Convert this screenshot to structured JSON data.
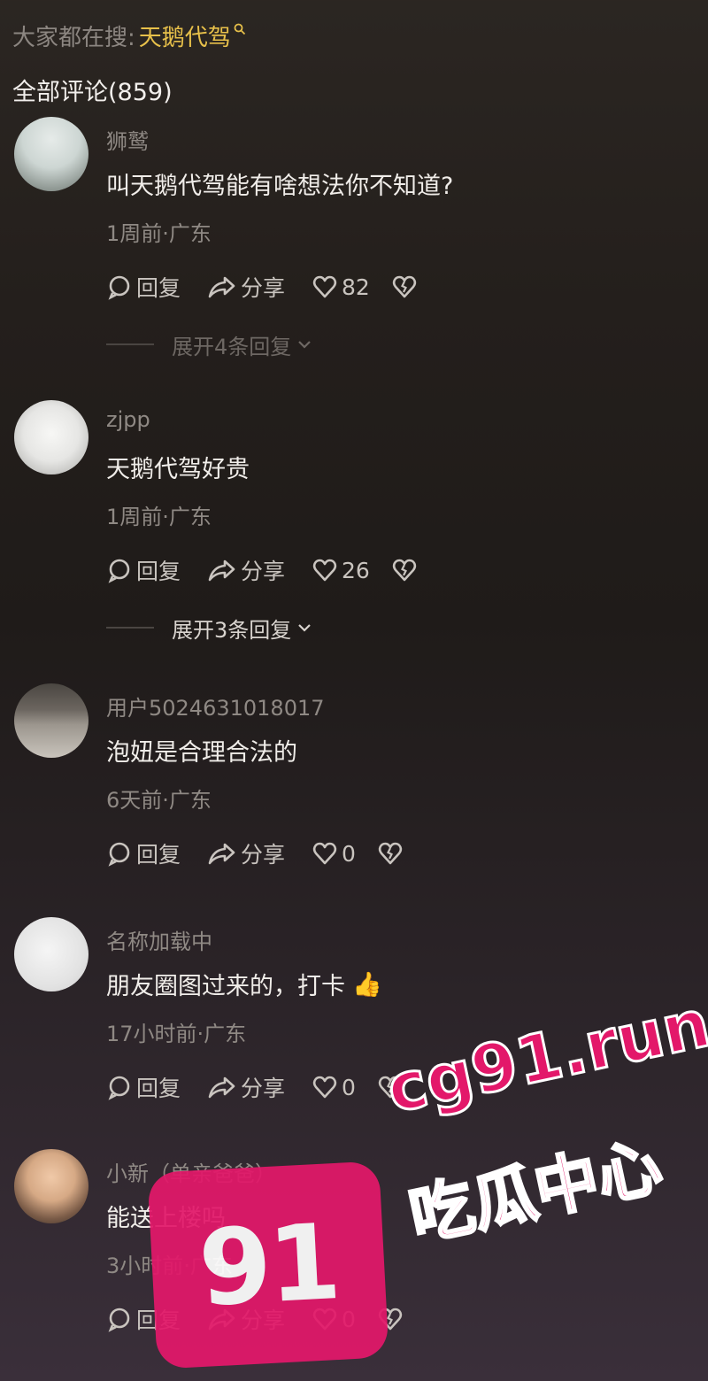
{
  "search_hint": {
    "prefix": "大家都在搜:",
    "keyword": "天鹅代驾"
  },
  "all_comments_label": "全部评论(859)",
  "labels": {
    "reply": "回复",
    "share": "分享"
  },
  "comments": [
    {
      "username": "狮鹫",
      "text": "叫天鹅代驾能有啥想法你不知道?",
      "meta": "1周前·广东",
      "likes": "82",
      "expand": "展开4条回复"
    },
    {
      "username": "zjpp",
      "text": "天鹅代驾好贵",
      "meta": "1周前·广东",
      "likes": "26",
      "expand": "展开3条回复"
    },
    {
      "username": "用户5024631018017",
      "text": "泡妞是合理合法的",
      "meta": "6天前·广东",
      "likes": "0"
    },
    {
      "username": "名称加载中",
      "text": "朋友圈图过来的，打卡",
      "meta": "17小时前·广东",
      "likes": "0",
      "emoji": "👍"
    },
    {
      "username": "小新（单亲爸爸）",
      "text": "能送上楼吗",
      "meta": "3小时前·广东",
      "likes": "0"
    }
  ],
  "watermark": {
    "number": "91",
    "url": "cg91.run",
    "name": "吃瓜中心"
  },
  "colors": {
    "accent_keyword": "#e7c04a",
    "watermark": "#e3186a"
  }
}
